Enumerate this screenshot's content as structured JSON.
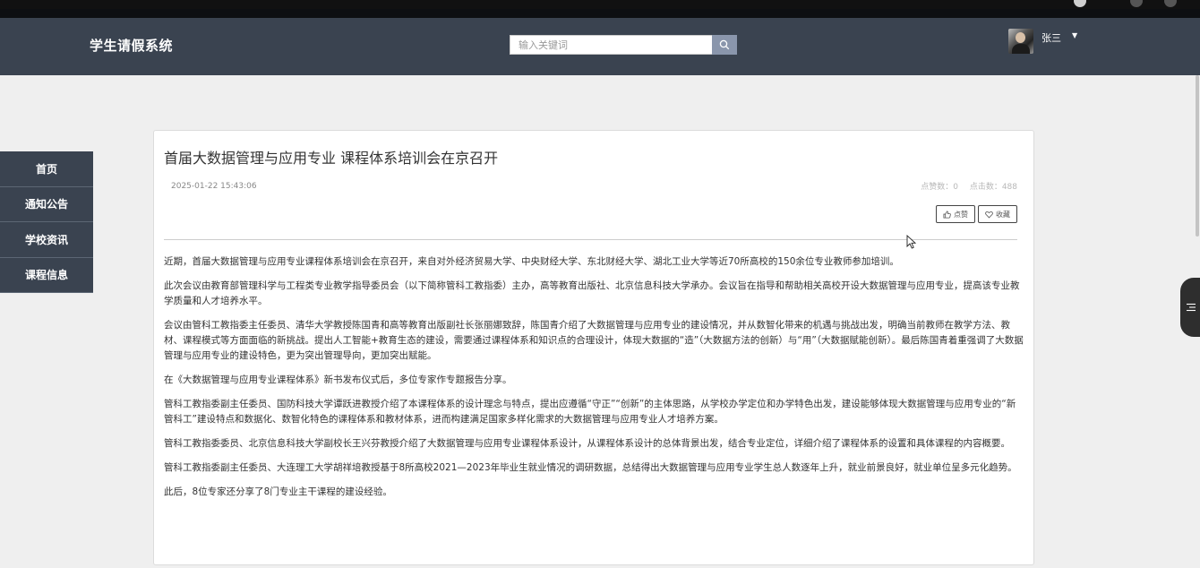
{
  "header": {
    "brand": "学生请假系统",
    "search_placeholder": "输入关键词",
    "user_name": "张三"
  },
  "sidenav": {
    "items": [
      {
        "label": "首页"
      },
      {
        "label": "通知公告"
      },
      {
        "label": "学校资讯"
      },
      {
        "label": "课程信息"
      }
    ]
  },
  "article": {
    "title": "首届大数据管理与应用专业 课程体系培训会在京召开",
    "date": "2025-01-22 15:43:06",
    "likes_label": "点赞数：0",
    "clicks_label": "点击数：488",
    "like_button": "点赞",
    "favorite_button": "收藏",
    "paragraphs": [
      "近期，首届大数据管理与应用专业课程体系培训会在京召开，来自对外经济贸易大学、中央财经大学、东北财经大学、湖北工业大学等近70所高校的150余位专业教师参加培训。",
      "此次会议由教育部管理科学与工程类专业教学指导委员会（以下简称管科工教指委）主办，高等教育出版社、北京信息科技大学承办。会议旨在指导和帮助相关高校开设大数据管理与应用专业，提高该专业教学质量和人才培养水平。",
      "会议由管科工教指委主任委员、清华大学教授陈国青和高等教育出版副社长张丽娜致辞，陈国青介绍了大数据管理与应用专业的建设情况，并从数智化带来的机遇与挑战出发，明确当前教师在教学方法、教材、课程模式等方面面临的新挑战。提出人工智能+教育生态的建设，需要通过课程体系和知识点的合理设计，体现大数据的“造”（大数据方法的创新）与“用”（大数据赋能创新）。最后陈国青着重强调了大数据管理与应用专业的建设特色，更为突出管理导向，更加突出赋能。",
      "在《大数据管理与应用专业课程体系》新书发布仪式后，多位专家作专题报告分享。",
      "管科工教指委副主任委员、国防科技大学谭跃进教授介绍了本课程体系的设计理念与特点，提出应遵循“守正”“创新”的主体思路，从学校办学定位和办学特色出发，建设能够体现大数据管理与应用专业的“新管科工”建设特点和数据化、数智化特色的课程体系和教材体系，进而构建满足国家多样化需求的大数据管理与应用专业人才培养方案。",
      "管科工教指委委员、北京信息科技大学副校长王兴芬教授介绍了大数据管理与应用专业课程体系设计，从课程体系设计的总体背景出发，结合专业定位，详细介绍了课程体系的设置和具体课程的内容概要。",
      "管科工教指委副主任委员、大连理工大学胡祥培教授基于8所高校2021—2023年毕业生就业情况的调研数据，总结得出大数据管理与应用专业学生总人数逐年上升，就业前景良好，就业单位呈多元化趋势。",
      "此后，8位专家还分享了8门专业主干课程的建设经验。"
    ]
  },
  "colors": {
    "header_bg": "#3a4350",
    "nav_bg": "#3a4350",
    "search_button": "#8a96ac",
    "page_bg": "#efefef"
  },
  "icons": {
    "search": "magnifier",
    "like": "thumbs-up",
    "favorite": "heart",
    "side_panel": "list"
  }
}
